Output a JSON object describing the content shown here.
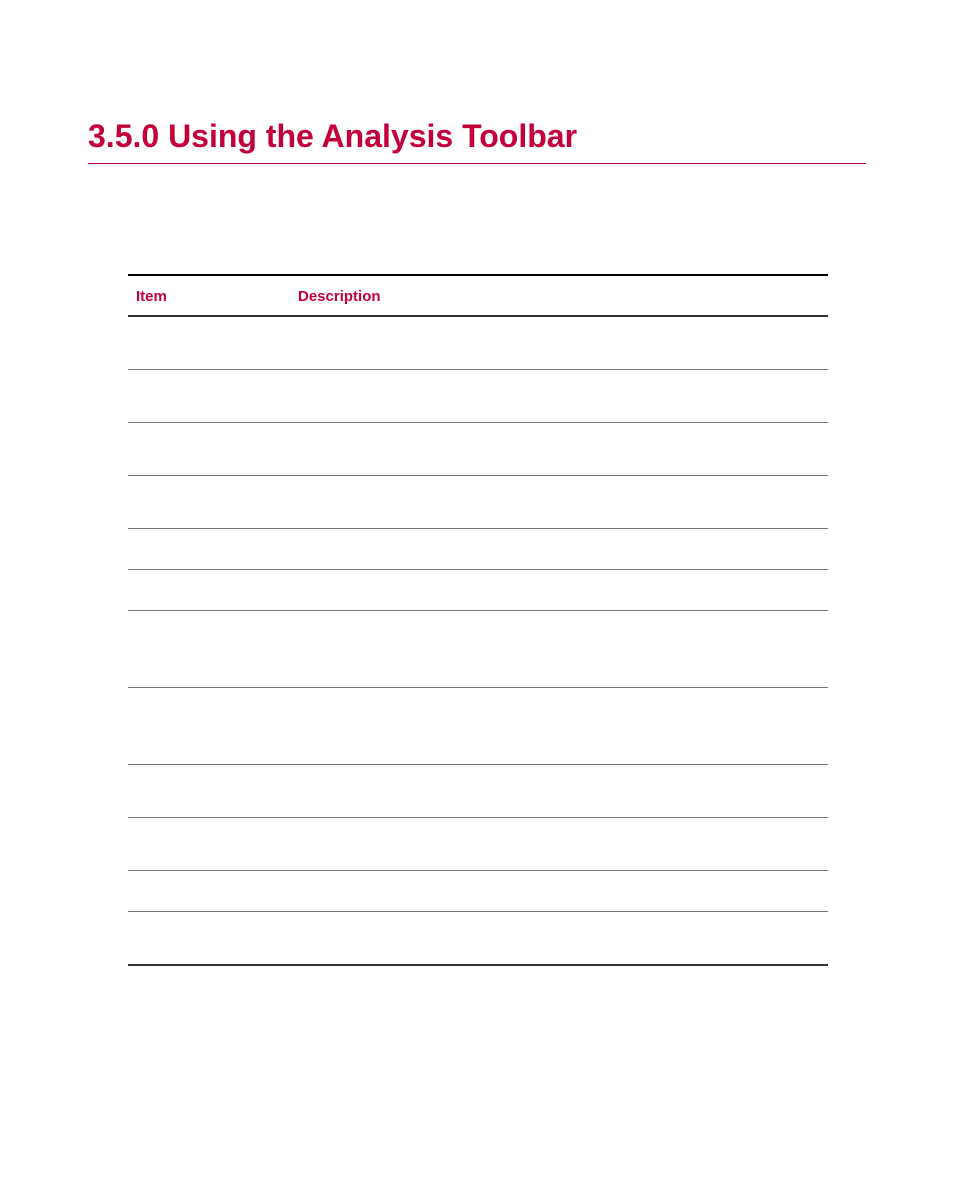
{
  "heading": "3.5.0 Using the Analysis Toolbar",
  "table": {
    "headers": {
      "item": "Item",
      "description": "Description"
    }
  }
}
